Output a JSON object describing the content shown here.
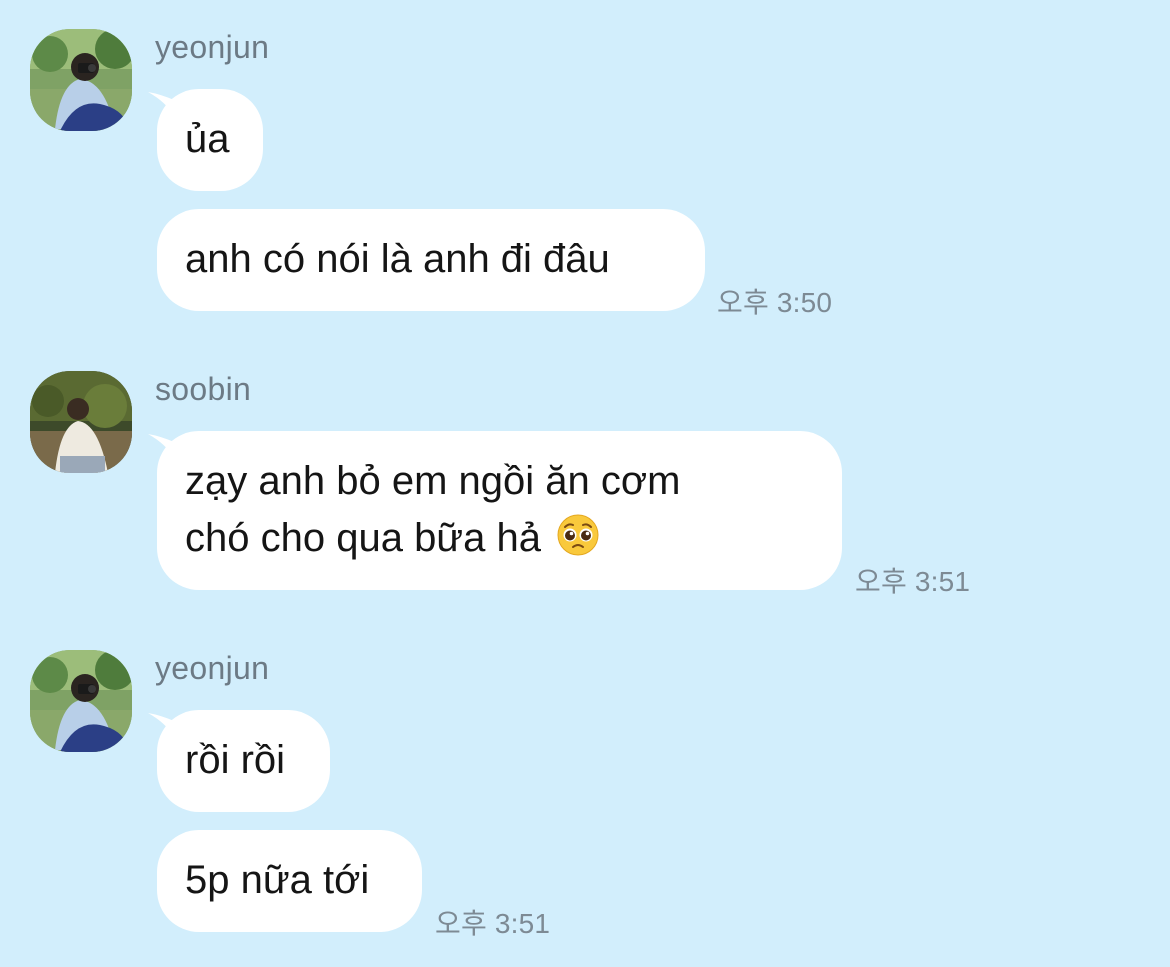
{
  "messages": [
    {
      "sender": "yeonjun",
      "avatar_icon": "yeonjun-avatar",
      "bubbles": [
        "ủa",
        "anh có nói là anh đi đâu"
      ],
      "time": "오후 3:50"
    },
    {
      "sender": "soobin",
      "avatar_icon": "soobin-avatar",
      "bubbles": [
        "zạy anh bỏ em ngồi ăn cơm",
        "chó cho qua bữa hả"
      ],
      "emoji": "pleading-face-icon",
      "time": "오후 3:51"
    },
    {
      "sender": "yeonjun",
      "avatar_icon": "yeonjun-avatar",
      "bubbles": [
        "rồi rồi",
        "5p nữa tới"
      ],
      "time": "오후 3:51"
    }
  ],
  "colors": {
    "background": "#d2eefc",
    "bubble": "#ffffff",
    "sender_text": "#6c7a85",
    "time_text": "#7d8a94"
  }
}
